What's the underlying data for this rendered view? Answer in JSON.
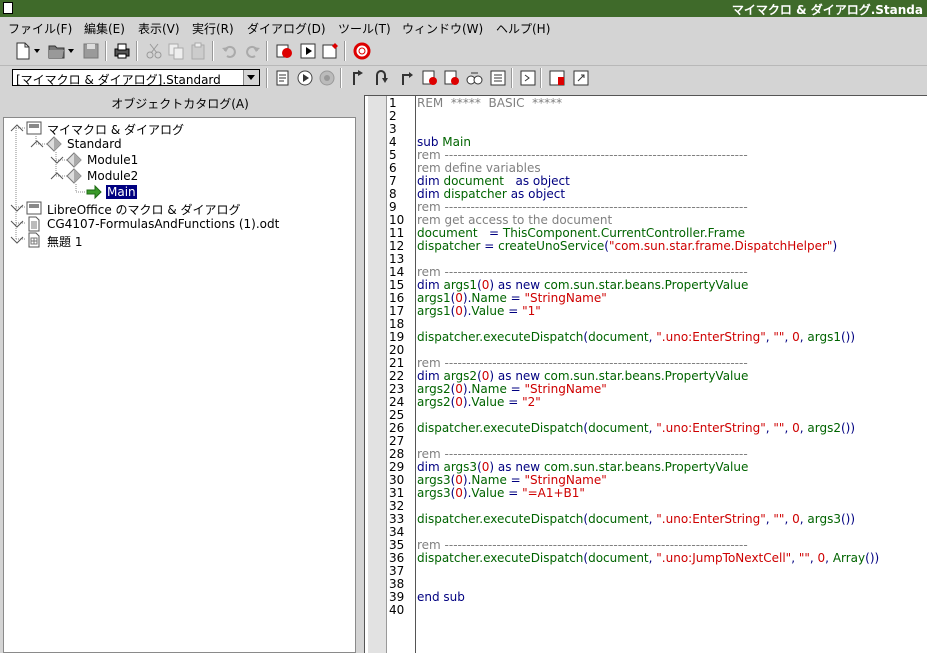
{
  "window": {
    "title": "マイマクロ & ダイアログ.Standa"
  },
  "menubar": {
    "items": [
      "ファイル(F)",
      "編集(E)",
      "表示(V)",
      "実行(R)",
      "ダイアログ(D)",
      "ツール(T)",
      "ウィンドウ(W)",
      "ヘルプ(H)"
    ]
  },
  "toolbar2": {
    "library_selected": "[マイマクロ & ダイアログ].Standard"
  },
  "catalog": {
    "title": "オブジェクトカタログ(A)",
    "tree": [
      {
        "label": "マイマクロ & ダイアログ",
        "level": 0,
        "icon": "library-container-icon",
        "expanded": true
      },
      {
        "label": "Standard",
        "level": 1,
        "icon": "basic-library-icon",
        "expanded": true
      },
      {
        "label": "Module1",
        "level": 2,
        "icon": "module-icon",
        "expanded": false
      },
      {
        "label": "Module2",
        "level": 2,
        "icon": "module-icon",
        "expanded": true
      },
      {
        "label": "Main",
        "level": 3,
        "icon": "macro-arrow-icon",
        "selected": true
      },
      {
        "label": "LibreOffice のマクロ & ダイアログ",
        "level": 0,
        "icon": "library-container-icon",
        "expanded": false
      },
      {
        "label": "CG4107-FormulasAndFunctions (1).odt",
        "level": 0,
        "icon": "text-document-icon",
        "expanded": false
      },
      {
        "label": "無題 1",
        "level": 0,
        "icon": "spreadsheet-document-icon",
        "expanded": false
      }
    ]
  },
  "editor": {
    "line_numbers": [
      "1",
      "2",
      "3",
      "4",
      "5",
      "6",
      "7",
      "8",
      "9",
      "10",
      "11",
      "12",
      "13",
      "14",
      "15",
      "16",
      "17",
      "18",
      "19",
      "20",
      "21",
      "22",
      "23",
      "24",
      "25",
      "26",
      "27",
      "28",
      "29",
      "30",
      "31",
      "32",
      "33",
      "34",
      "35",
      "36",
      "37",
      "38",
      "39",
      "40"
    ],
    "lines": [
      [
        [
          "c-com",
          "REM  *****  BASIC  *****"
        ]
      ],
      [],
      [],
      [
        [
          "c-kw",
          "sub "
        ],
        [
          "c-id",
          "Main"
        ]
      ],
      [
        [
          "c-com",
          "rem ----------------------------------------------------------------------"
        ]
      ],
      [
        [
          "c-com",
          "rem define variables"
        ]
      ],
      [
        [
          "c-kw",
          "dim "
        ],
        [
          "c-id",
          "document"
        ],
        [
          "c-kw",
          "   as object"
        ]
      ],
      [
        [
          "c-kw",
          "dim "
        ],
        [
          "c-id",
          "dispatcher"
        ],
        [
          "c-kw",
          " as object"
        ]
      ],
      [
        [
          "c-com",
          "rem ----------------------------------------------------------------------"
        ]
      ],
      [
        [
          "c-com",
          "rem get access to the document"
        ]
      ],
      [
        [
          "c-id",
          "document"
        ],
        [
          "c-op",
          "   = "
        ],
        [
          "c-id",
          "ThisComponent.CurrentController.Frame"
        ]
      ],
      [
        [
          "c-id",
          "dispatcher"
        ],
        [
          "c-op",
          " = "
        ],
        [
          "c-id",
          "createUnoService"
        ],
        [
          "c-op",
          "("
        ],
        [
          "c-str",
          "\"com.sun.star.frame.DispatchHelper\""
        ],
        [
          "c-op",
          ")"
        ]
      ],
      [],
      [
        [
          "c-com",
          "rem ----------------------------------------------------------------------"
        ]
      ],
      [
        [
          "c-kw",
          "dim "
        ],
        [
          "c-id",
          "args1"
        ],
        [
          "c-op",
          "("
        ],
        [
          "c-num",
          "0"
        ],
        [
          "c-op",
          ")"
        ],
        [
          "c-kw",
          " as new "
        ],
        [
          "c-id",
          "com.sun.star.beans.PropertyValue"
        ]
      ],
      [
        [
          "c-id",
          "args1"
        ],
        [
          "c-op",
          "("
        ],
        [
          "c-num",
          "0"
        ],
        [
          "c-op",
          ")."
        ],
        [
          "c-id",
          "Name"
        ],
        [
          "c-op",
          " = "
        ],
        [
          "c-str",
          "\"StringName\""
        ]
      ],
      [
        [
          "c-id",
          "args1"
        ],
        [
          "c-op",
          "("
        ],
        [
          "c-num",
          "0"
        ],
        [
          "c-op",
          ")."
        ],
        [
          "c-id",
          "Value"
        ],
        [
          "c-op",
          " = "
        ],
        [
          "c-str",
          "\"1\""
        ]
      ],
      [],
      [
        [
          "c-id",
          "dispatcher.executeDispatch"
        ],
        [
          "c-op",
          "("
        ],
        [
          "c-id",
          "document"
        ],
        [
          "c-op",
          ", "
        ],
        [
          "c-str",
          "\".uno:EnterString\""
        ],
        [
          "c-op",
          ", "
        ],
        [
          "c-str",
          "\"\""
        ],
        [
          "c-op",
          ", "
        ],
        [
          "c-num",
          "0"
        ],
        [
          "c-op",
          ", "
        ],
        [
          "c-id",
          "args1"
        ],
        [
          "c-op",
          "())"
        ]
      ],
      [],
      [
        [
          "c-com",
          "rem ----------------------------------------------------------------------"
        ]
      ],
      [
        [
          "c-kw",
          "dim "
        ],
        [
          "c-id",
          "args2"
        ],
        [
          "c-op",
          "("
        ],
        [
          "c-num",
          "0"
        ],
        [
          "c-op",
          ")"
        ],
        [
          "c-kw",
          " as new "
        ],
        [
          "c-id",
          "com.sun.star.beans.PropertyValue"
        ]
      ],
      [
        [
          "c-id",
          "args2"
        ],
        [
          "c-op",
          "("
        ],
        [
          "c-num",
          "0"
        ],
        [
          "c-op",
          ")."
        ],
        [
          "c-id",
          "Name"
        ],
        [
          "c-op",
          " = "
        ],
        [
          "c-str",
          "\"StringName\""
        ]
      ],
      [
        [
          "c-id",
          "args2"
        ],
        [
          "c-op",
          "("
        ],
        [
          "c-num",
          "0"
        ],
        [
          "c-op",
          ")."
        ],
        [
          "c-id",
          "Value"
        ],
        [
          "c-op",
          " = "
        ],
        [
          "c-str",
          "\"2\""
        ]
      ],
      [],
      [
        [
          "c-id",
          "dispatcher.executeDispatch"
        ],
        [
          "c-op",
          "("
        ],
        [
          "c-id",
          "document"
        ],
        [
          "c-op",
          ", "
        ],
        [
          "c-str",
          "\".uno:EnterString\""
        ],
        [
          "c-op",
          ", "
        ],
        [
          "c-str",
          "\"\""
        ],
        [
          "c-op",
          ", "
        ],
        [
          "c-num",
          "0"
        ],
        [
          "c-op",
          ", "
        ],
        [
          "c-id",
          "args2"
        ],
        [
          "c-op",
          "())"
        ]
      ],
      [],
      [
        [
          "c-com",
          "rem ----------------------------------------------------------------------"
        ]
      ],
      [
        [
          "c-kw",
          "dim "
        ],
        [
          "c-id",
          "args3"
        ],
        [
          "c-op",
          "("
        ],
        [
          "c-num",
          "0"
        ],
        [
          "c-op",
          ")"
        ],
        [
          "c-kw",
          " as new "
        ],
        [
          "c-id",
          "com.sun.star.beans.PropertyValue"
        ]
      ],
      [
        [
          "c-id",
          "args3"
        ],
        [
          "c-op",
          "("
        ],
        [
          "c-num",
          "0"
        ],
        [
          "c-op",
          ")."
        ],
        [
          "c-id",
          "Name"
        ],
        [
          "c-op",
          " = "
        ],
        [
          "c-str",
          "\"StringName\""
        ]
      ],
      [
        [
          "c-id",
          "args3"
        ],
        [
          "c-op",
          "("
        ],
        [
          "c-num",
          "0"
        ],
        [
          "c-op",
          ")."
        ],
        [
          "c-id",
          "Value"
        ],
        [
          "c-op",
          " = "
        ],
        [
          "c-str",
          "\"=A1+B1\""
        ]
      ],
      [],
      [
        [
          "c-id",
          "dispatcher.executeDispatch"
        ],
        [
          "c-op",
          "("
        ],
        [
          "c-id",
          "document"
        ],
        [
          "c-op",
          ", "
        ],
        [
          "c-str",
          "\".uno:EnterString\""
        ],
        [
          "c-op",
          ", "
        ],
        [
          "c-str",
          "\"\""
        ],
        [
          "c-op",
          ", "
        ],
        [
          "c-num",
          "0"
        ],
        [
          "c-op",
          ", "
        ],
        [
          "c-id",
          "args3"
        ],
        [
          "c-op",
          "())"
        ]
      ],
      [],
      [
        [
          "c-com",
          "rem ----------------------------------------------------------------------"
        ]
      ],
      [
        [
          "c-id",
          "dispatcher.executeDispatch"
        ],
        [
          "c-op",
          "("
        ],
        [
          "c-id",
          "document"
        ],
        [
          "c-op",
          ", "
        ],
        [
          "c-str",
          "\".uno:JumpToNextCell\""
        ],
        [
          "c-op",
          ", "
        ],
        [
          "c-str",
          "\"\""
        ],
        [
          "c-op",
          ", "
        ],
        [
          "c-num",
          "0"
        ],
        [
          "c-op",
          ", "
        ],
        [
          "c-id",
          "Array"
        ],
        [
          "c-op",
          "())"
        ]
      ],
      [],
      [],
      [
        [
          "c-kw",
          "end sub"
        ]
      ],
      []
    ]
  }
}
